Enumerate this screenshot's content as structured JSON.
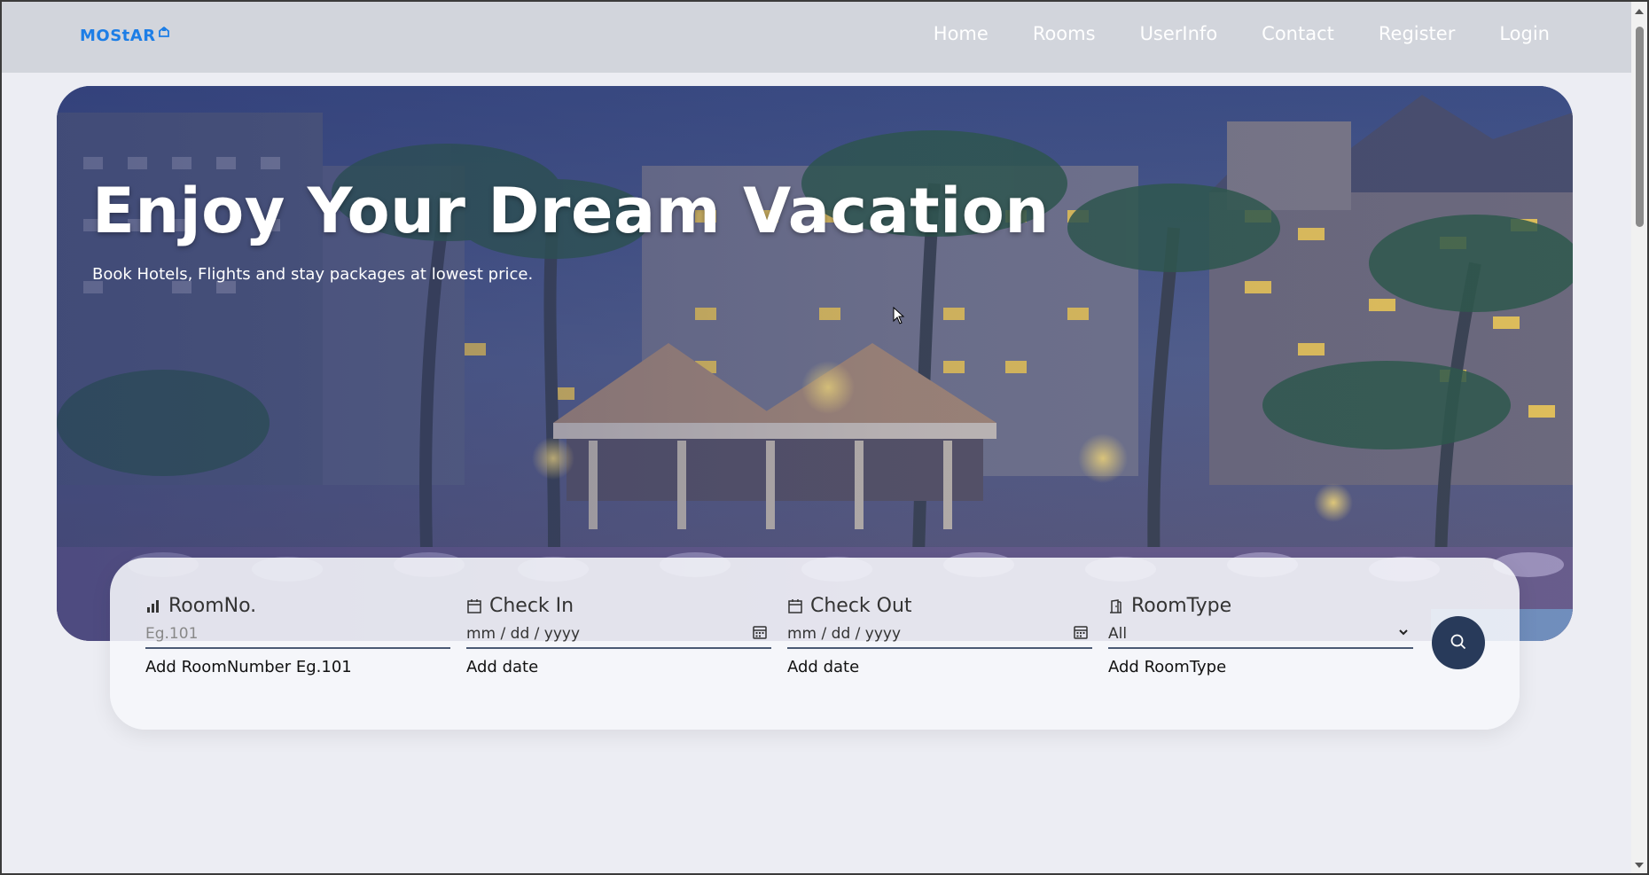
{
  "brand": {
    "logo_text": "MOStAR",
    "logo_icon": "house-icon"
  },
  "nav": {
    "items": [
      {
        "label": "Home"
      },
      {
        "label": "Rooms"
      },
      {
        "label": "UserInfo"
      },
      {
        "label": "Contact"
      },
      {
        "label": "Register"
      },
      {
        "label": "Login"
      }
    ]
  },
  "hero": {
    "title": "Enjoy Your Dream Vacation",
    "subtitle": "Book Hotels, Flights and stay packages at lowest price."
  },
  "search": {
    "room_no": {
      "label": "RoomNo.",
      "placeholder": "Eg.101",
      "help": "Add RoomNumber Eg.101",
      "icon": "bar-chart-icon"
    },
    "check_in": {
      "label": "Check In",
      "value": "mm / dd / yyyy",
      "help": "Add date",
      "icon": "calendar-icon"
    },
    "check_out": {
      "label": "Check Out",
      "value": "mm / dd / yyyy",
      "help": "Add date",
      "icon": "calendar-icon"
    },
    "room_type": {
      "label": "RoomType",
      "value": "All",
      "help": "Add RoomType",
      "icon": "door-icon"
    },
    "button_icon": "search-icon"
  },
  "colors": {
    "brand": "#1d7ee6",
    "navbar_bg": "#d2d5dc",
    "search_button": "#283a5a"
  }
}
